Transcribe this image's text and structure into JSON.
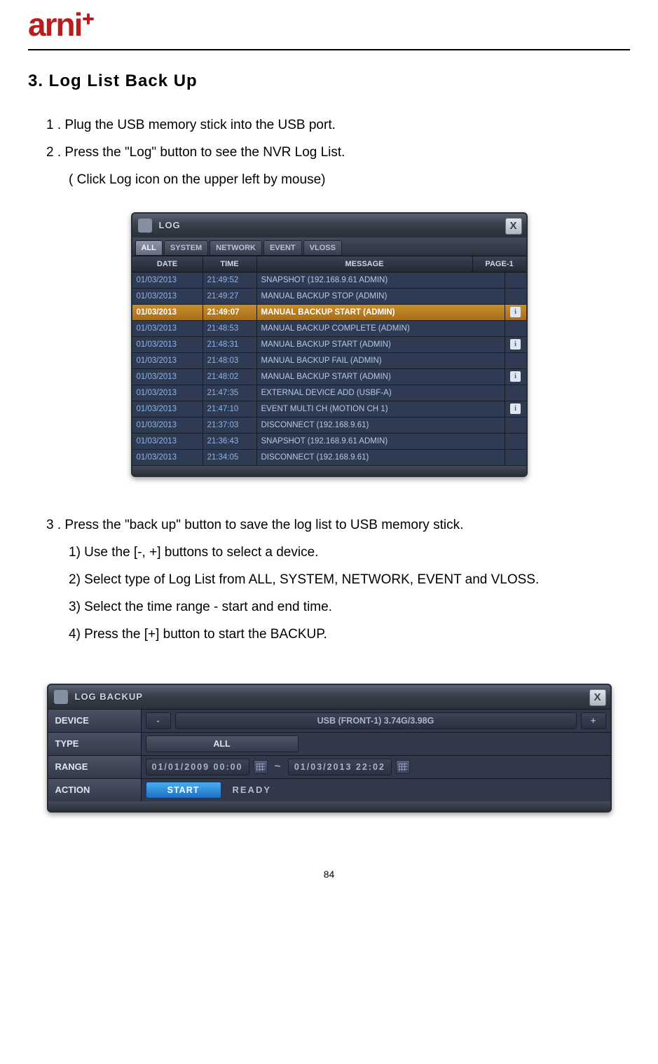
{
  "logo_text": "arni",
  "section_title": "3.  Log  List  Back  Up",
  "step1": "1 . Plug the USB memory stick into the USB port.",
  "step2": "2 . Press the \"Log\" button to see the NVR Log List.",
  "step2_sub": "( Click Log icon on the upper left by mouse)",
  "logWindow": {
    "title": "LOG",
    "close": "X",
    "tabs": [
      "ALL",
      "SYSTEM",
      "NETWORK",
      "EVENT",
      "VLOSS"
    ],
    "active_tab": 0,
    "head": {
      "date": "DATE",
      "time": "TIME",
      "msg": "MESSAGE",
      "page": "PAGE-1"
    },
    "rows": [
      {
        "date": "01/03/2013",
        "time": "21:49:52",
        "msg": "SNAPSHOT (192.168.9.61 ADMIN)",
        "info": false,
        "sel": false
      },
      {
        "date": "01/03/2013",
        "time": "21:49:27",
        "msg": "MANUAL BACKUP STOP (ADMIN)",
        "info": false,
        "sel": false
      },
      {
        "date": "01/03/2013",
        "time": "21:49:07",
        "msg": "MANUAL BACKUP START (ADMIN)",
        "info": true,
        "sel": true
      },
      {
        "date": "01/03/2013",
        "time": "21:48:53",
        "msg": "MANUAL BACKUP COMPLETE (ADMIN)",
        "info": false,
        "sel": false
      },
      {
        "date": "01/03/2013",
        "time": "21:48:31",
        "msg": "MANUAL BACKUP START (ADMIN)",
        "info": true,
        "sel": false
      },
      {
        "date": "01/03/2013",
        "time": "21:48:03",
        "msg": "MANUAL BACKUP FAIL (ADMIN)",
        "info": false,
        "sel": false
      },
      {
        "date": "01/03/2013",
        "time": "21:48:02",
        "msg": "MANUAL BACKUP START (ADMIN)",
        "info": true,
        "sel": false
      },
      {
        "date": "01/03/2013",
        "time": "21:47:35",
        "msg": "EXTERNAL DEVICE ADD (USBF-A)",
        "info": false,
        "sel": false
      },
      {
        "date": "01/03/2013",
        "time": "21:47:10",
        "msg": "EVENT MULTI CH (MOTION CH 1)",
        "info": true,
        "sel": false
      },
      {
        "date": "01/03/2013",
        "time": "21:37:03",
        "msg": "DISCONNECT (192.168.9.61)",
        "info": false,
        "sel": false
      },
      {
        "date": "01/03/2013",
        "time": "21:36:43",
        "msg": "SNAPSHOT (192.168.9.61 ADMIN)",
        "info": false,
        "sel": false
      },
      {
        "date": "01/03/2013",
        "time": "21:34:05",
        "msg": "DISCONNECT (192.168.9.61)",
        "info": false,
        "sel": false
      }
    ]
  },
  "step3": "3 . Press the \"back up\" button to save the log list to USB memory stick.",
  "step3_sub": [
    "1)   Use the [-, +] buttons to select a device.",
    "2)   Select type of Log List from ALL, SYSTEM, NETWORK, EVENT and VLOSS.",
    "3)   Select the time range - start and end time.",
    "4)    Press the [+] button to start the BACKUP."
  ],
  "backupWindow": {
    "title": "LOG BACKUP",
    "close": "X",
    "labels": {
      "device": "DEVICE",
      "type": "TYPE",
      "range": "RANGE",
      "action": "ACTION"
    },
    "device_minus": "-",
    "device_value": "USB (FRONT-1) 3.74G/3.98G",
    "device_plus": "+",
    "type_value": "ALL",
    "range_from": "01/01/2009 00:00",
    "range_to": "01/03/2013 22:02",
    "range_sep": "~",
    "action_start": "START",
    "action_ready": "READY"
  },
  "page_number": "84"
}
